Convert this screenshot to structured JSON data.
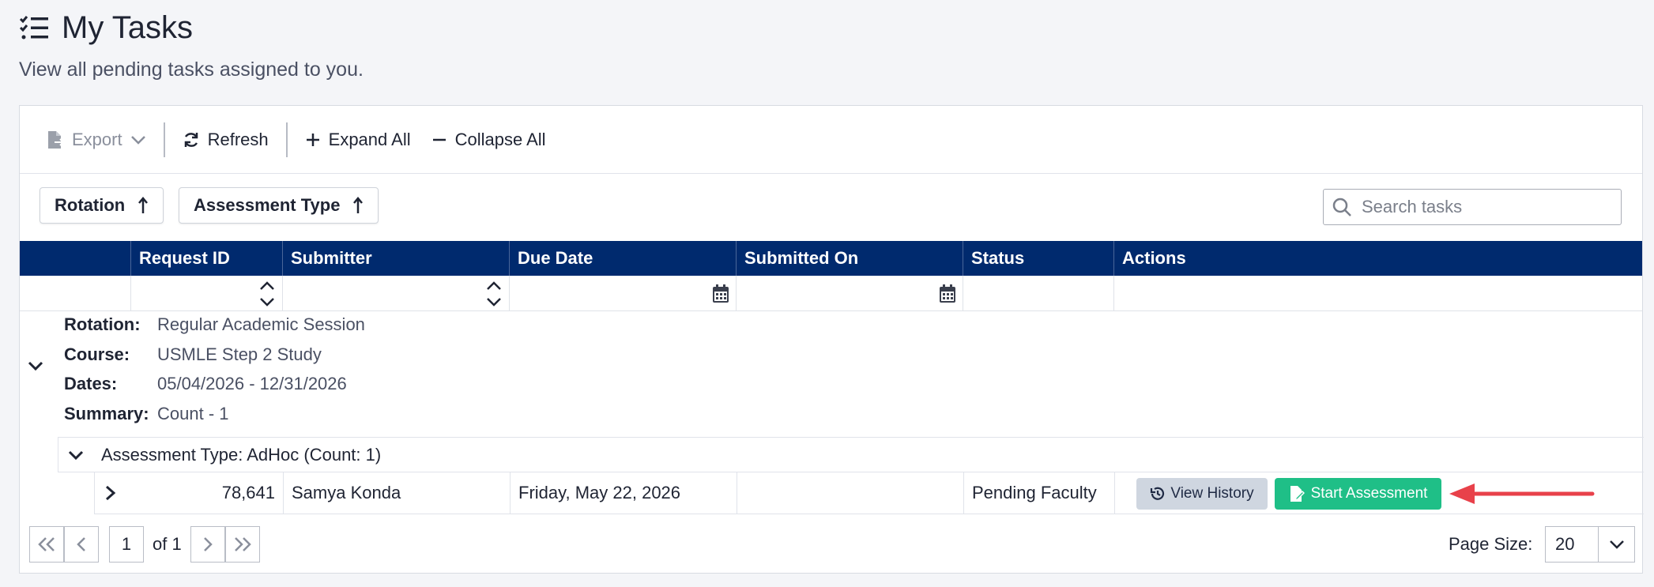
{
  "page": {
    "title": "My Tasks",
    "subtitle": "View all pending tasks assigned to you."
  },
  "toolbar": {
    "export_label": "Export",
    "refresh_label": "Refresh",
    "expand_all_label": "Expand All",
    "collapse_all_label": "Collapse All"
  },
  "grouping": {
    "chips": [
      {
        "label": "Rotation",
        "direction": "ascending"
      },
      {
        "label": "Assessment Type",
        "direction": "ascending"
      }
    ]
  },
  "search": {
    "placeholder": "Search tasks",
    "value": ""
  },
  "table": {
    "columns": [
      "Request ID",
      "Submitter",
      "Due Date",
      "Submitted On",
      "Status",
      "Actions"
    ],
    "group": {
      "rotation_label": "Rotation:",
      "rotation_value": "Regular Academic Session",
      "course_label": "Course:",
      "course_value": "USMLE Step 2 Study",
      "dates_label": "Dates:",
      "dates_value": "05/04/2026 - 12/31/2026",
      "summary_label": "Summary:",
      "summary_value": "Count - 1"
    },
    "subgroup": {
      "label": "Assessment Type: AdHoc (Count: 1)"
    },
    "rows": [
      {
        "request_id": "78,641",
        "submitter": "Samya Konda",
        "due_date": "Friday, May 22, 2026",
        "submitted_on": "",
        "status": "Pending Faculty",
        "actions": {
          "history_label": "View History",
          "start_label": "Start Assessment"
        }
      }
    ]
  },
  "pager": {
    "current_page": "1",
    "of_text": "of 1",
    "page_size_label": "Page Size:",
    "page_size": "20"
  },
  "colors": {
    "header_bg": "#002a6e",
    "start_button": "#1fbf87",
    "history_button": "#cfd6e0",
    "arrow": "#e8414a"
  }
}
